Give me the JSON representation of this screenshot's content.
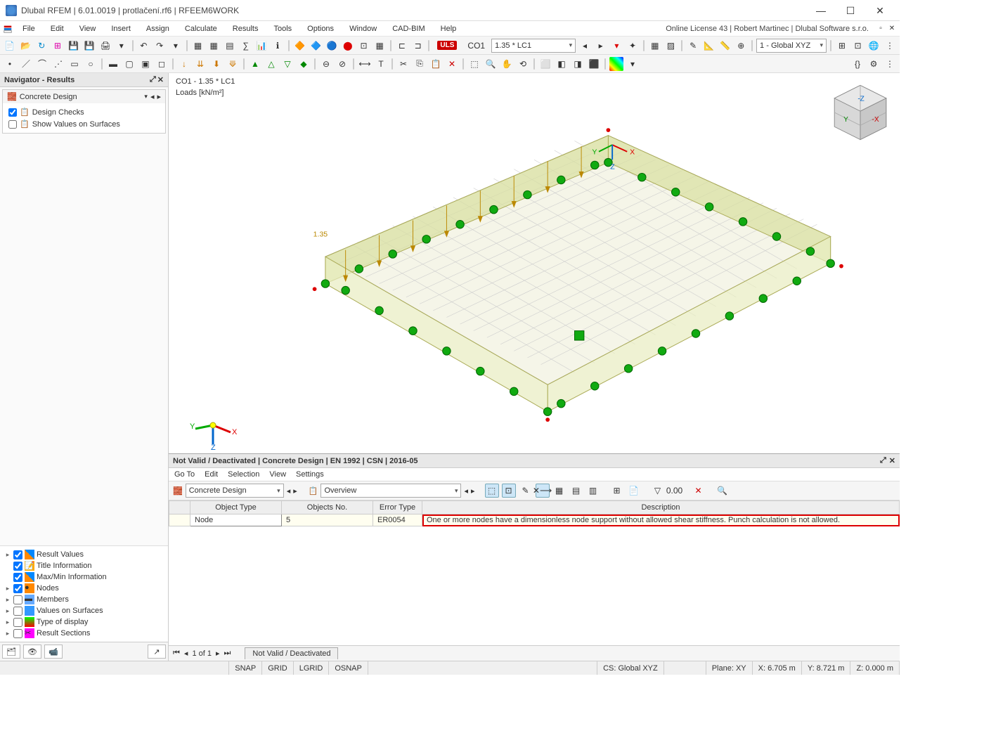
{
  "title": "Dlubal RFEM | 6.01.0019 | protlačení.rf6 | RFEEM6WORK",
  "license": "Online License 43 | Robert Martinec | Dlubal Software s.r.o.",
  "menu": [
    "File",
    "Edit",
    "View",
    "Insert",
    "Assign",
    "Calculate",
    "Results",
    "Tools",
    "Options",
    "Window",
    "CAD-BIM",
    "Help"
  ],
  "toolbar1": {
    "uls": "ULS",
    "co1": "CO1",
    "co1_desc": "1.35 * LC1",
    "global_select": "1 - Global XYZ"
  },
  "navigator": {
    "title": "Navigator - Results",
    "section": "Concrete Design",
    "items": [
      {
        "label": "Design Checks",
        "checked": true
      },
      {
        "label": "Show Values on Surfaces",
        "checked": false
      }
    ],
    "tree": [
      "Result Values",
      "Title Information",
      "Max/Min Information",
      "Nodes",
      "Members",
      "Values on Surfaces",
      "Type of display",
      "Result Sections"
    ],
    "tree_checked": [
      true,
      true,
      true,
      true,
      false,
      false,
      false,
      false
    ]
  },
  "viewport": {
    "line1": "CO1 - 1.35 * LC1",
    "line2": "Loads [kN/m²]",
    "load_value": "1.35"
  },
  "bottom": {
    "header": "Not Valid / Deactivated | Concrete Design | EN 1992 | CSN | 2016-05",
    "menu": [
      "Go To",
      "Edit",
      "Selection",
      "View",
      "Settings"
    ],
    "combo1": "Concrete Design",
    "combo2": "Overview",
    "columns": [
      "Object Type",
      "Objects No.",
      "Error Type",
      "Description"
    ],
    "row": {
      "obj_type": "Node",
      "objects_no": "5",
      "error_type": "ER0054",
      "description": "One or more nodes have a dimensionless node support without allowed shear stiffness. Punch calculation is not allowed."
    },
    "pager": {
      "pos": "1 of 1",
      "tab": "Not Valid / Deactivated"
    }
  },
  "status": {
    "snap": "SNAP",
    "grid": "GRID",
    "lgrid": "LGRID",
    "osnap": "OSNAP",
    "cs": "CS: Global XYZ",
    "plane": "Plane: XY",
    "x": "X: 6.705 m",
    "y": "Y: 8.721 m",
    "z": "Z: 0.000 m"
  }
}
